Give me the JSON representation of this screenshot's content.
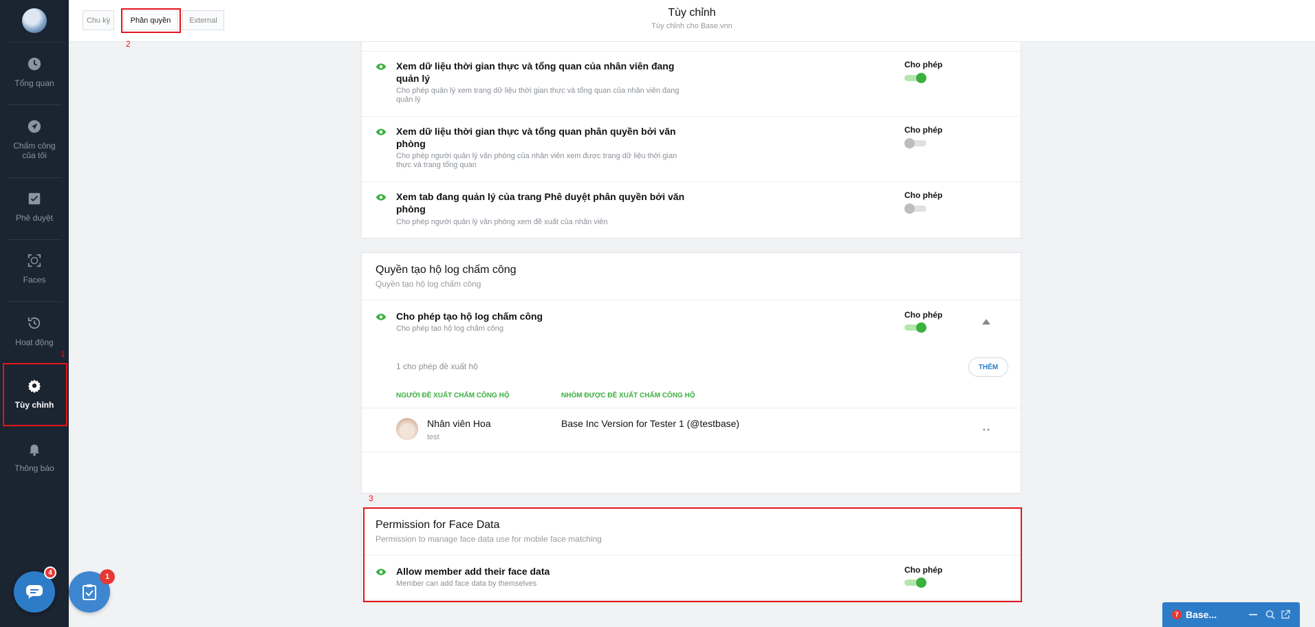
{
  "sidebar": {
    "items": [
      {
        "label": "Tổng quan"
      },
      {
        "label": "Chấm công của tôi"
      },
      {
        "label": "Phê duyệt"
      },
      {
        "label": "Faces"
      },
      {
        "label": "Hoạt động"
      },
      {
        "label": "Tùy chỉnh"
      },
      {
        "label": "Thông báo"
      }
    ],
    "chat_badge": "4",
    "task_badge": "1"
  },
  "annotations": [
    "1",
    "2",
    "3"
  ],
  "header": {
    "tabs": [
      "Chu kỳ",
      "Phân quyền",
      "External"
    ],
    "title": "Tùy chỉnh",
    "subtitle": "Tùy chỉnh cho Base.vnn"
  },
  "card1": {
    "rows": [
      {
        "title": "Xem dữ liệu thời gian thực và tổng quan của nhân viên đang quản lý",
        "desc": "Cho phép quản lý xem trang dữ liệu thời gian thực và tổng quan của nhân viên đang quản lý",
        "allow": "Cho phép",
        "on": true
      },
      {
        "title": "Xem dữ liệu thời gian thực và tổng quan phân quyền bởi văn phòng",
        "desc": "Cho phép người quản lý văn phòng của nhân viên xem được trang dữ liệu thời gian thực và trang tổng quan",
        "allow": "Cho phép",
        "on": false
      },
      {
        "title": "Xem tab đang quản lý của trang Phê duyệt phân quyền bởi văn phòng",
        "desc": "Cho phép người quản lý văn phòng xem đề xuất của nhân viên",
        "allow": "Cho phép",
        "on": false
      }
    ]
  },
  "card2": {
    "title": "Quyền tạo hộ log chấm công",
    "subtitle": "Quyền tạo hộ log chấm công",
    "row": {
      "title": "Cho phép tạo hộ log chấm công",
      "desc": "Cho phép tạo hộ log chấm công",
      "allow": "Cho phép",
      "on": true
    },
    "count_text": "1 cho phép đề xuất hộ",
    "add_button": "THÊM",
    "col_proposer": "NGƯỜI ĐỀ XUẤT CHẤM CÔNG HỘ",
    "col_group": "NHÓM ĐƯỢC ĐỀ XUẤT CHẤM CÔNG HỘ",
    "entry": {
      "name": "Nhân viên Hoa",
      "sub": "test",
      "group": "Base Inc Version for Tester 1 (@testbase)"
    }
  },
  "card3": {
    "title": "Permission for Face Data",
    "subtitle": "Permission to manage face data use for mobile face matching",
    "row": {
      "title": "Allow member add their face data",
      "desc": "Member can add face data by themselves",
      "allow": "Cho phép",
      "on": true
    }
  },
  "dock": {
    "badge": "7",
    "label": "Base..."
  }
}
